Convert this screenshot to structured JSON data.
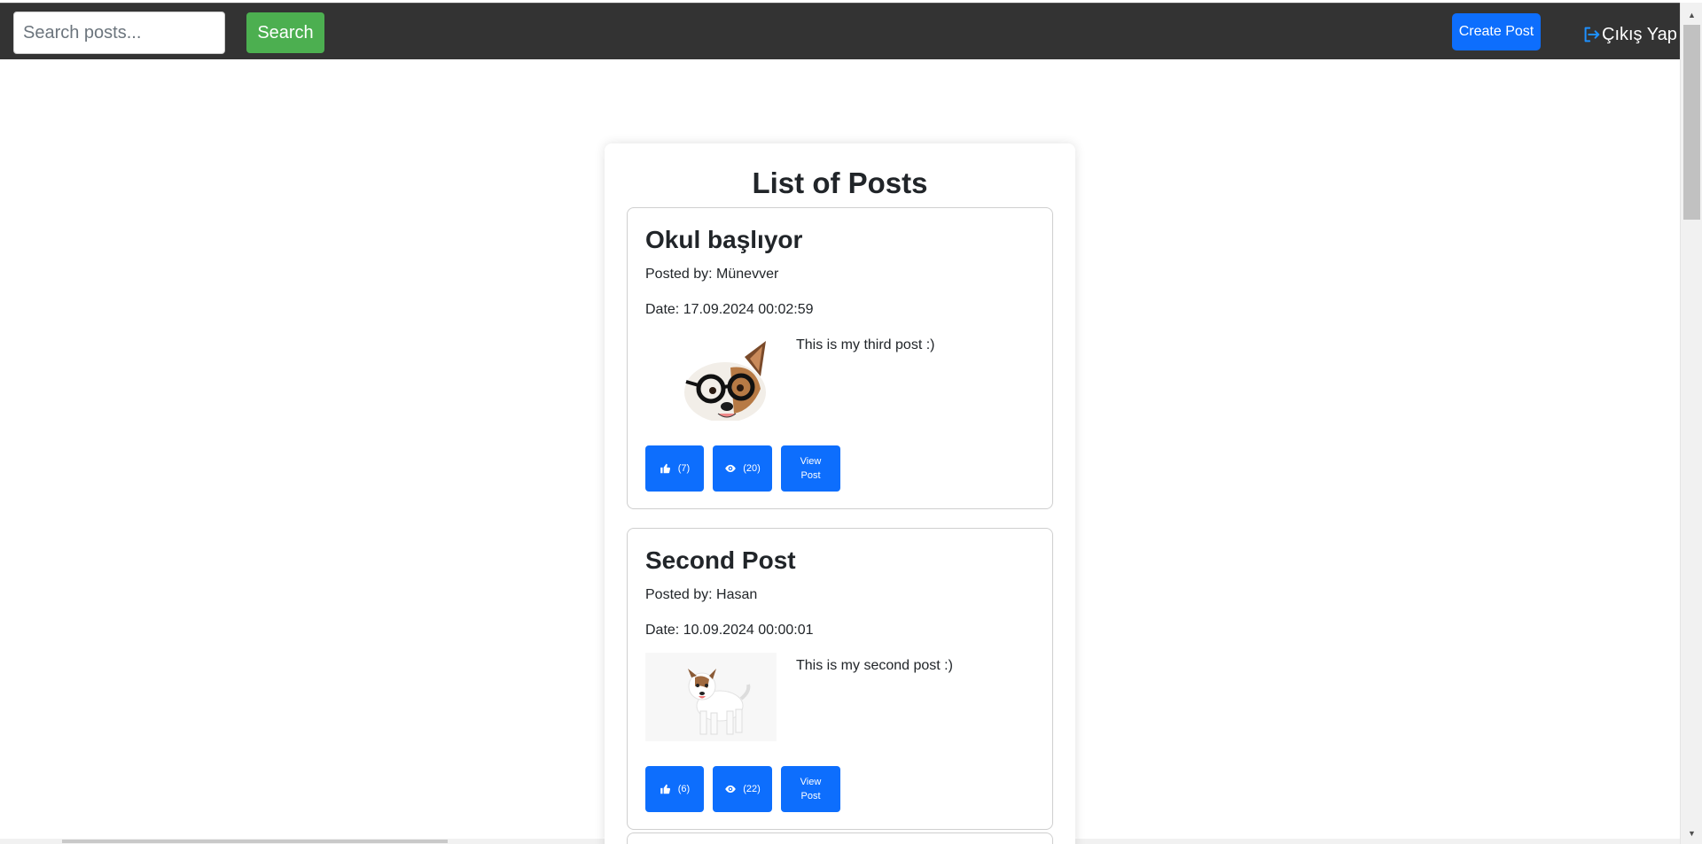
{
  "topbar": {
    "search_placeholder": "Search posts...",
    "search_label": "Search",
    "create_label": "Create Post",
    "logout_label": "Çıkış Yap"
  },
  "main": {
    "title": "List of Posts"
  },
  "posts": [
    {
      "title": "Okul başlıyor",
      "author": "Posted by: Münevver",
      "date": "Date: 17.09.2024 00:02:59",
      "text": "This is my third post :)",
      "image": "dog-with-glasses",
      "likes": "(7)",
      "views": "(20)",
      "view_line1": "View",
      "view_line2": "Post"
    },
    {
      "title": "Second Post",
      "author": "Posted by: Hasan",
      "date": "Date: 10.09.2024 00:00:01",
      "text": "This is my second post :)",
      "image": "small-white-dog",
      "likes": "(6)",
      "views": "(22)",
      "view_line1": "View",
      "view_line2": "Post"
    }
  ],
  "colors": {
    "topbar": "#333333",
    "search_button": "#4caf50",
    "primary": "#0d6efd"
  }
}
